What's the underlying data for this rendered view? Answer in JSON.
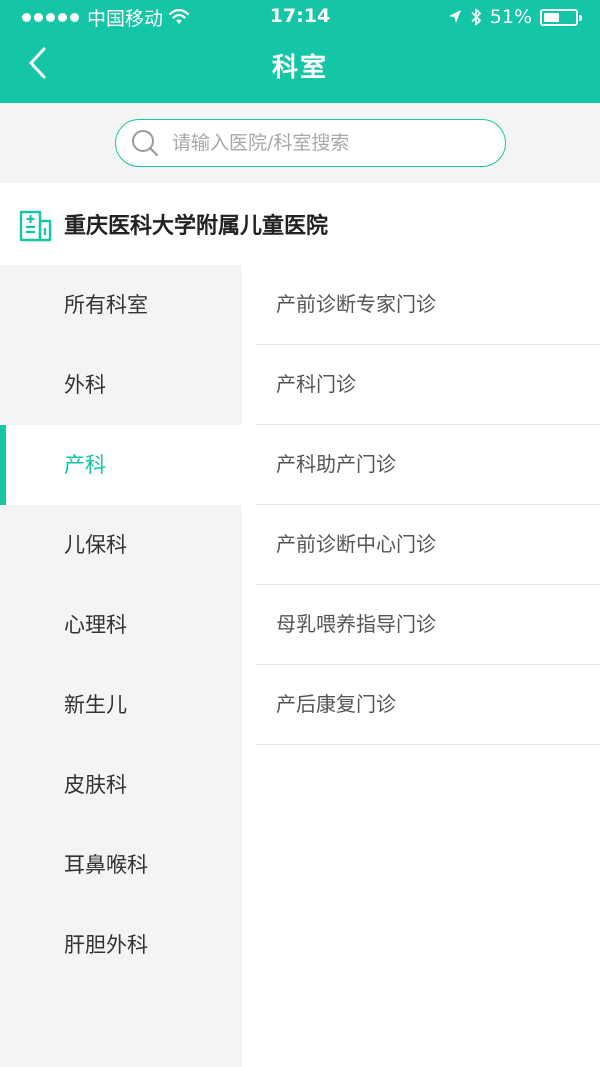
{
  "status_bar": {
    "carrier": "中国移动",
    "time": "17:14",
    "battery": "51%",
    "battery_level": 0.51
  },
  "header": {
    "title": "科室",
    "back_icon": "chevron-left-icon"
  },
  "search": {
    "placeholder": "请输入医院/科室搜索",
    "icon": "search-icon"
  },
  "hospital": {
    "name": "重庆医科大学附属儿童医院",
    "icon": "hospital-icon"
  },
  "departments": [
    {
      "label": "所有科室"
    },
    {
      "label": "外科"
    },
    {
      "label": "产科",
      "active": true
    },
    {
      "label": "儿保科"
    },
    {
      "label": "心理科"
    },
    {
      "label": "新生儿"
    },
    {
      "label": "皮肤科"
    },
    {
      "label": "耳鼻喉科"
    },
    {
      "label": "肝胆外科"
    }
  ],
  "clinics": [
    {
      "label": "产前诊断专家门诊"
    },
    {
      "label": "产科门诊"
    },
    {
      "label": "产科助产门诊"
    },
    {
      "label": "产前诊断中心门诊"
    },
    {
      "label": "母乳喂养指导门诊"
    },
    {
      "label": "产后康复门诊"
    }
  ],
  "colors": {
    "accent": "#14c6a5",
    "background": "#f4f4f4"
  }
}
